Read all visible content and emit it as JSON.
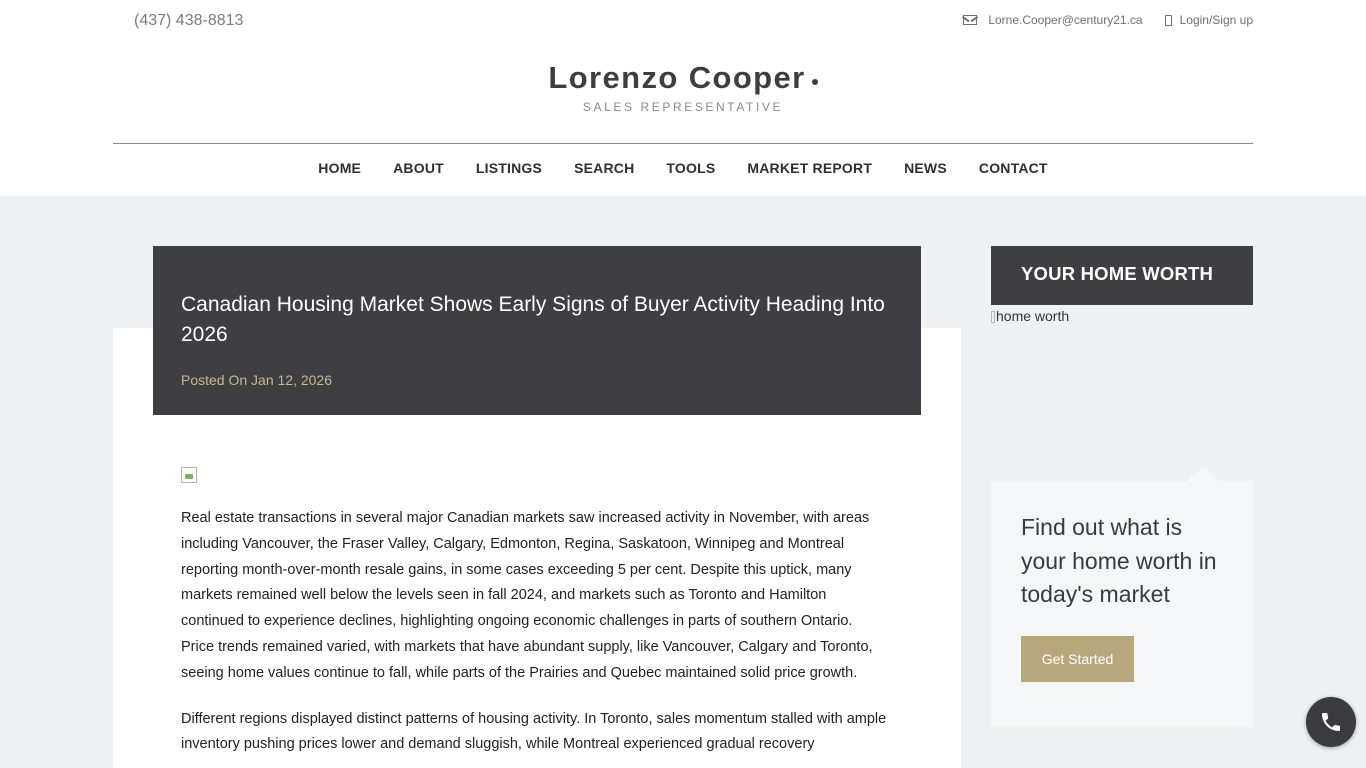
{
  "topbar": {
    "phone": "(437) 438-8813",
    "email": "Lorne.Cooper@century21.ca",
    "login": "Login/Sign up"
  },
  "brand": {
    "name": "Lorenzo Cooper",
    "title": "SALES REPRESENTATIVE"
  },
  "nav": {
    "items": [
      "HOME",
      "ABOUT",
      "LISTINGS",
      "SEARCH",
      "TOOLS",
      "MARKET REPORT",
      "NEWS",
      "CONTACT"
    ]
  },
  "article": {
    "title": "Canadian Housing Market Shows Early Signs of Buyer Activity Heading Into 2026",
    "posted": "Posted On Jan 12, 2026",
    "paragraphs": [
      "Real estate transactions in several major Canadian markets saw increased activity in November, with areas including Vancouver, the Fraser Valley, Calgary, Edmonton, Regina, Saskatoon, Winnipeg and Montreal reporting month-over-month resale gains, in some cases exceeding 5 per cent. Despite this uptick, many markets remained well below the levels seen in fall 2024, and markets such as Toronto and Hamilton continued to experience declines, highlighting ongoing economic challenges in parts of southern Ontario. Price trends remained varied, with markets that have abundant supply, like Vancouver, Calgary and Toronto, seeing home values continue to fall, while parts of the Prairies and Quebec maintained solid price growth.",
      "Different regions displayed distinct patterns of housing activity. In Toronto, sales momentum stalled with ample inventory pushing prices lower and demand sluggish, while Montreal experienced gradual recovery"
    ]
  },
  "sidebar": {
    "heading": "YOUR HOME WORTH",
    "image_alt": "home worth",
    "card_text": "Find out what is your home worth in today's market",
    "button": "Get Started"
  },
  "icons": {
    "mail": "mail-icon",
    "login": "device-icon",
    "call": "phone-icon"
  },
  "colors": {
    "dark": "#3f3e42",
    "gold": "#b7a77b",
    "date": "#c7b98a"
  }
}
